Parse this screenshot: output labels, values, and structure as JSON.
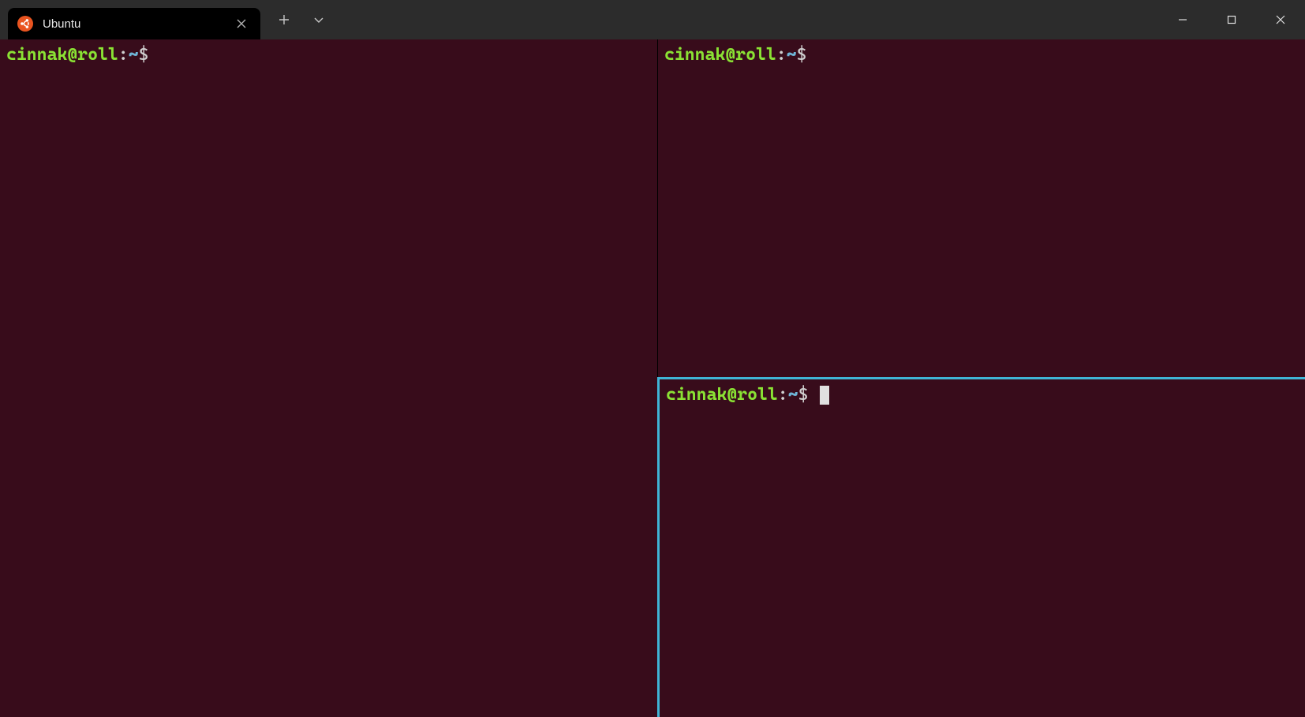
{
  "titlebar": {
    "tab": {
      "title": "Ubuntu",
      "icon_name": "ubuntu-logo-icon"
    }
  },
  "panes": {
    "left": {
      "prompt_userhost": "cinnak@roll",
      "prompt_colon": ":",
      "prompt_path": "~",
      "prompt_dollar": "$ "
    },
    "top_right": {
      "prompt_userhost": "cinnak@roll",
      "prompt_colon": ":",
      "prompt_path": "~",
      "prompt_dollar": "$ "
    },
    "bottom_right": {
      "prompt_userhost": "cinnak@roll",
      "prompt_colon": ":",
      "prompt_path": "~",
      "prompt_dollar": "$ ",
      "active": true
    }
  },
  "colors": {
    "terminal_bg": "#380c1b",
    "accent_focus": "#3fb5d6",
    "ubuntu_orange": "#E95420"
  }
}
